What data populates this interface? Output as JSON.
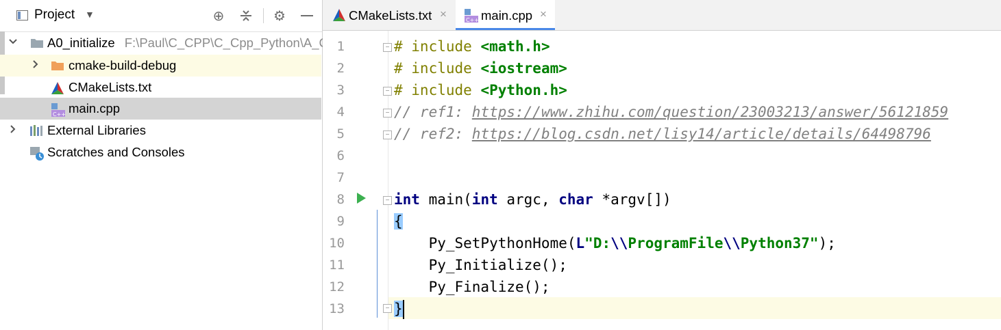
{
  "project_pane": {
    "title": "Project",
    "tree": [
      {
        "label": "A0_initialize",
        "path": "F:\\Paul\\C_CPP\\C_Cpp_Python\\A_C",
        "icon": "folder-icon",
        "expanded": true
      },
      {
        "label": "cmake-build-debug",
        "icon": "folder-icon",
        "expanded": false
      },
      {
        "label": "CMakeLists.txt",
        "icon": "cmake-icon"
      },
      {
        "label": "main.cpp",
        "icon": "cpp-file-icon",
        "selected": true
      },
      {
        "label": "External Libraries",
        "icon": "libraries-icon",
        "expanded": false
      },
      {
        "label": "Scratches and Consoles",
        "icon": "scratches-icon"
      }
    ]
  },
  "editor": {
    "tabs": [
      {
        "label": "CMakeLists.txt",
        "icon": "cmake-icon",
        "active": false,
        "close": "×"
      },
      {
        "label": "main.cpp",
        "icon": "cpp-file-icon",
        "active": true,
        "close": "×"
      }
    ],
    "line_numbers": [
      "1",
      "2",
      "3",
      "4",
      "5",
      "6",
      "7",
      "8",
      "9",
      "10",
      "11",
      "12",
      "13"
    ],
    "code": {
      "l1_kw": "# include",
      "l1_inc": "<math.h>",
      "l2_kw": "# include",
      "l2_inc": "<iostream>",
      "l3_kw": "# include",
      "l3_inc": "<Python.h>",
      "l4_cmt": "// ref1: ",
      "l4_url": "https://www.zhihu.com/question/23003213/answer/56121859",
      "l5_cmt": "// ref2: ",
      "l5_url": "https://blog.csdn.net/lisy14/article/details/64498796",
      "l8_kw1": "int",
      "l8_t1": " main(",
      "l8_kw2": "int",
      "l8_t2": " argc, ",
      "l8_kw3": "char",
      "l8_t3": " *argv[])",
      "l9_brace": "{",
      "l10_t1": "    Py_SetPythonHome(",
      "l10_kwL": "L",
      "l10_s1": "\"D:",
      "l10_e1": "\\\\",
      "l10_s2": "ProgramFile",
      "l10_e2": "\\\\",
      "l10_s3": "Python37\"",
      "l10_t2": ");",
      "l11": "    Py_Initialize();",
      "l12": "    Py_Finalize();",
      "l13_brace": "}"
    }
  },
  "colors": {
    "keyword": "#000080",
    "string": "#008000",
    "preprocessor": "#808000",
    "comment": "#808080",
    "current_line": "#fdfbe4",
    "selection": "#d4d4d4"
  }
}
